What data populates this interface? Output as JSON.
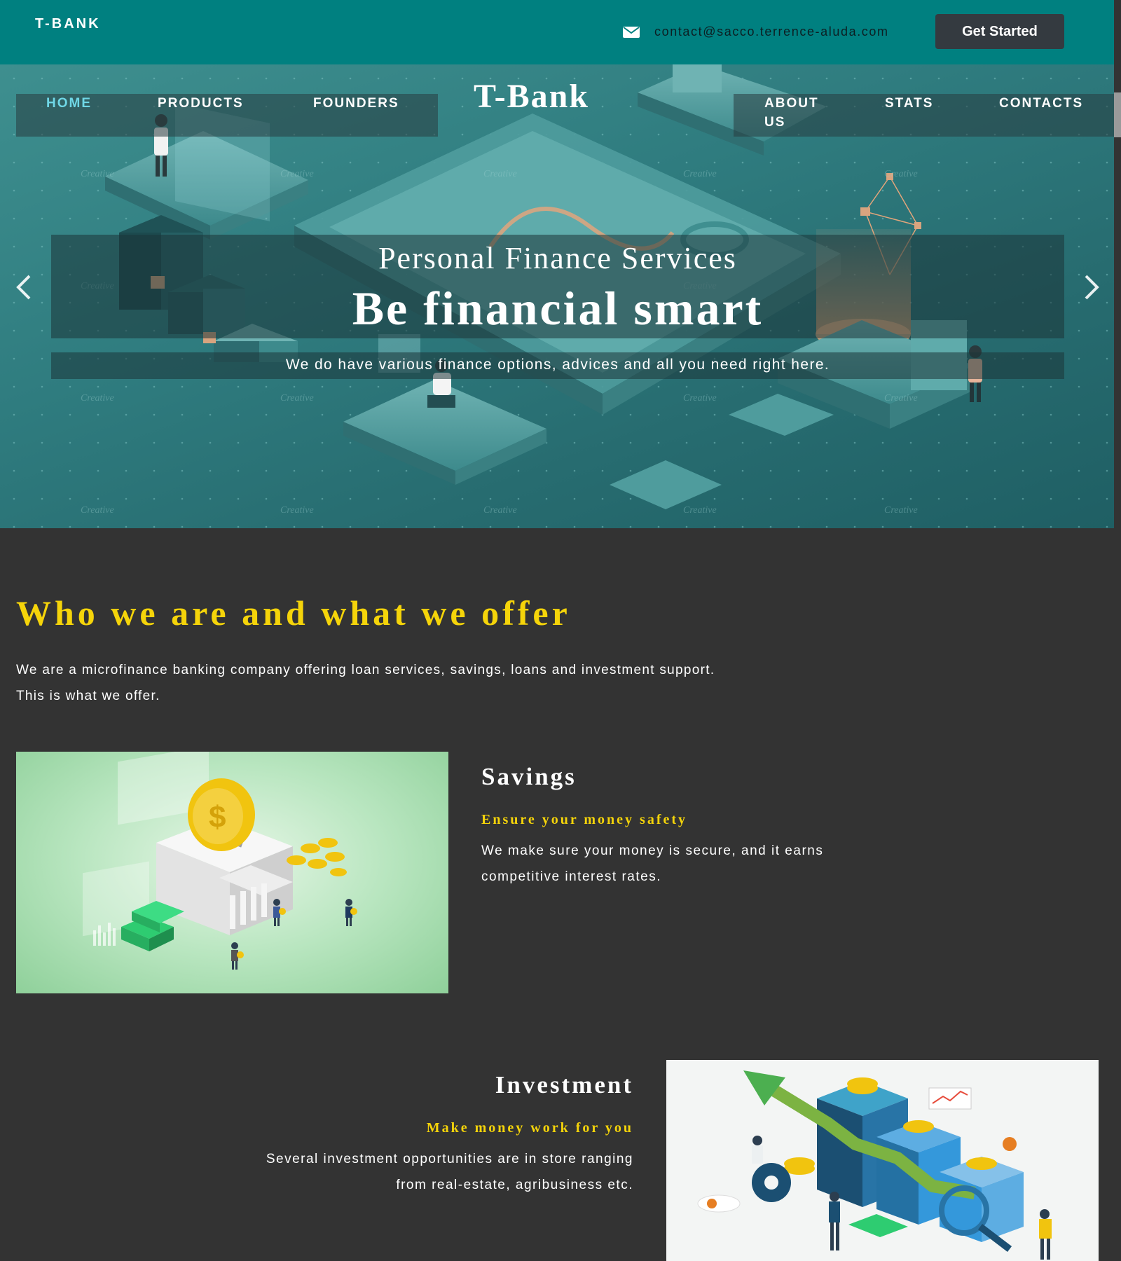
{
  "topbar": {
    "brand": "T-BANK",
    "email": "contact@sacco.terrence-aluda.com",
    "cta_label": "Get Started"
  },
  "nav": {
    "brand": "T-Bank",
    "items": [
      {
        "label": "HOME",
        "active": true
      },
      {
        "label": "PRODUCTS",
        "active": false
      },
      {
        "label": "FOUNDERS",
        "active": false
      },
      {
        "label": "ABOUT",
        "label2": "US",
        "active": false
      },
      {
        "label": "STATS",
        "active": false
      },
      {
        "label": "CONTACTS",
        "active": false
      }
    ]
  },
  "hero": {
    "subtitle": "Personal Finance Services",
    "title": "Be financial smart",
    "text": "We do have various finance options, advices and all you need right here.",
    "watermark": "Creative"
  },
  "about": {
    "title": "Who we are and what we offer",
    "line1": "We are a microfinance banking company offering loan services, savings, loans and investment support.",
    "line2": "This is what we offer."
  },
  "savings": {
    "title": "Savings",
    "subtitle": "Ensure your money safety",
    "text": "We make sure your money is secure, and it earns competitive interest rates."
  },
  "investment": {
    "title": "Investment",
    "subtitle": "Make money work for you",
    "line1": "Several investment opportunities are in store ranging",
    "line2": "from real-estate, agribusiness etc."
  },
  "icons": {
    "mail": "envelope-icon",
    "prev": "chevron-left-icon",
    "next": "chevron-right-icon"
  },
  "colors": {
    "topbar": "#008080",
    "accent": "#f5d40a",
    "nav_active": "#6fd7e6",
    "button": "#343a40",
    "page_bg": "#333333"
  }
}
